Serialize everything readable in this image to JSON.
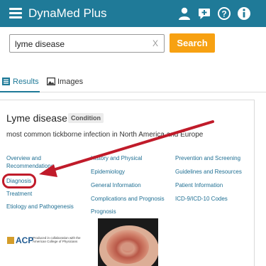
{
  "header": {
    "brand": "DynaMed Plus",
    "icons": [
      "user-icon",
      "chat-icon",
      "help-icon",
      "info-icon"
    ],
    "background": "#1f7a98"
  },
  "search": {
    "value": "lyme disease",
    "clear": "X",
    "button": "Search",
    "button_color": "#f7a112"
  },
  "tabs": [
    {
      "label": "Results",
      "active": true
    },
    {
      "label": "Images",
      "active": false
    }
  ],
  "card": {
    "title": "Lyme disease",
    "badge": "Condition",
    "description": "most common tickborne infection in North America and Europe",
    "links": {
      "col1": [
        "Overview and Recommendations",
        "Diagnosis",
        "Treatment",
        "Etiology and Pathogenesis"
      ],
      "col2": [
        "History and Physical",
        "Epidemiology",
        "General Information",
        "Complications and Prognosis",
        "Prognosis"
      ],
      "col3": [
        "Prevention and Screening",
        "Guidelines and Resources",
        "Patient Information",
        "ICD-9/ICD-10 Codes"
      ]
    },
    "acp": {
      "letters": "ACP",
      "text": "Produced in collaboration with the American College of Physicians"
    }
  },
  "annotation": {
    "color": "#c01b2a",
    "target": "Diagnosis"
  }
}
